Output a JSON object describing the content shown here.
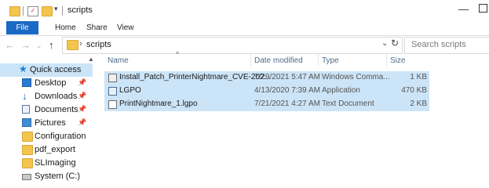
{
  "window": {
    "title": "scripts"
  },
  "ribbon": {
    "file": "File",
    "tabs": [
      "Home",
      "Share",
      "View"
    ]
  },
  "address": {
    "path": "scripts"
  },
  "search": {
    "placeholder": "Search scripts"
  },
  "nav_pane": {
    "quick_access": "Quick access",
    "items": [
      {
        "label": "Desktop",
        "icon": "desktop-icon",
        "pinned": true
      },
      {
        "label": "Downloads",
        "icon": "downloads-icon",
        "pinned": true
      },
      {
        "label": "Documents",
        "icon": "documents-icon",
        "pinned": true
      },
      {
        "label": "Pictures",
        "icon": "pictures-icon",
        "pinned": true
      },
      {
        "label": "Configuration",
        "icon": "folder-icon",
        "pinned": false
      },
      {
        "label": "pdf_export",
        "icon": "folder-icon",
        "pinned": false
      },
      {
        "label": "SLImaging",
        "icon": "folder-icon",
        "pinned": false
      },
      {
        "label": "System (C:)",
        "icon": "drive-icon",
        "pinned": false
      }
    ]
  },
  "columns": {
    "name": "Name",
    "date": "Date modified",
    "type": "Type",
    "size": "Size"
  },
  "files": [
    {
      "name": "Install_Patch_PrinterNightmare_CVE-202...",
      "date": "7/29/2021 5:47 AM",
      "type": "Windows Comma...",
      "size": "1 KB",
      "icon": "cmd-file-icon"
    },
    {
      "name": "LGPO",
      "date": "4/13/2020 7:39 AM",
      "type": "Application",
      "size": "470 KB",
      "icon": "application-icon"
    },
    {
      "name": "PrintNightmare_1.lgpo",
      "date": "7/21/2021 4:27 AM",
      "type": "Text Document",
      "size": "2 KB",
      "icon": "text-document-icon"
    }
  ],
  "colors": {
    "accent": "#1a69c4",
    "selection": "#cce4f7",
    "folder": "#f3c54c"
  }
}
